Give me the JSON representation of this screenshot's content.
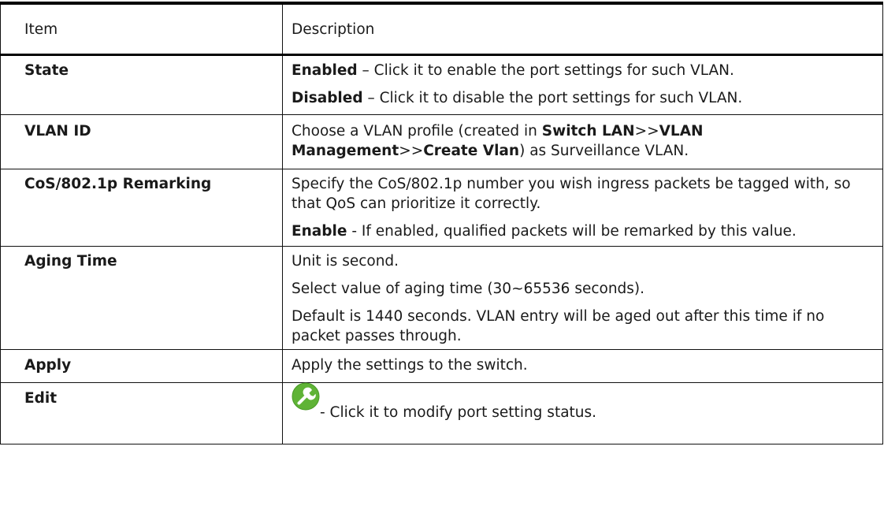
{
  "table": {
    "header": {
      "item": "Item",
      "description": "Description"
    },
    "rows": {
      "state": {
        "item": "State",
        "enabled_label": "Enabled",
        "enabled_text": " – Click it to enable the port settings for such VLAN.",
        "disabled_label": "Disabled",
        "disabled_text": " – Click it to disable the port settings for such VLAN."
      },
      "vlan_id": {
        "item": "VLAN ID",
        "t1": "Choose a VLAN profile (created in ",
        "b1": "Switch LAN",
        "t2": ">>",
        "b2": "VLAN Management",
        "t3": ">>",
        "b3": "Create Vlan",
        "t4": ") as Surveillance VLAN."
      },
      "cos": {
        "item": "CoS/802.1p Remarking",
        "p1": "Specify the CoS/802.1p number you wish ingress packets be tagged with, so that QoS can prioritize it correctly.",
        "enable_label": "Enable",
        "enable_text": " - If enabled, qualified packets will be remarked by this value."
      },
      "aging": {
        "item": "Aging Time",
        "p1": "Unit is second.",
        "p2": "Select value of aging time (30~65536 seconds).",
        "p3": "Default is 1440 seconds. VLAN entry will be aged out after this time if no packet passes through."
      },
      "apply": {
        "item": "Apply",
        "p1": "Apply the settings to the switch."
      },
      "edit": {
        "item": "Edit",
        "icon": "wrench-icon",
        "p1": "- Click it to modify port setting status."
      }
    }
  },
  "colors": {
    "icon_green": "#5fb336",
    "border": "#111111",
    "text": "#1a1a1a"
  }
}
